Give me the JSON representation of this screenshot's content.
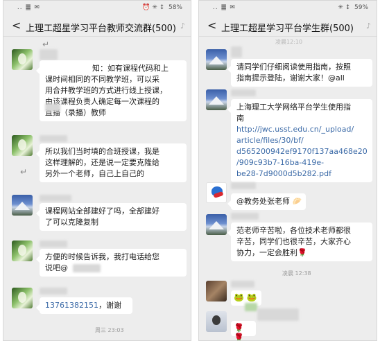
{
  "left": {
    "status_icons": " .. ䷀ ✉",
    "status_right": "⏰ ✳ ↕  58%",
    "back_glyph": "<",
    "title": "上理工超星学习平台教师交流群(500)",
    "bell": "♪",
    "messages": [
      {
        "lines": [
          "知：如有课程代码和上",
          "课时间相同的不同教学班，可以采",
          "用合并教学班的方式进行线上授课，",
          "由该课程负责人确定每一次课程的",
          "直播（录播）教师"
        ]
      },
      {
        "lines": [
          "所以我们当时填的合班授课，我是",
          "这样理解的，还是说一定要克隆给",
          "另外一个老师，自己上自己的"
        ]
      },
      {
        "lines": [
          "课程网站全部建好了吗，全部建好",
          "了可以克隆复制"
        ]
      },
      {
        "lines": [
          "方便的时候告诉我，我打电话给您",
          "说吧@"
        ]
      },
      {
        "phone": "13761382151",
        "suffix": "，谢谢"
      }
    ],
    "timestamp": "周三 23:03",
    "return_mark": "↵"
  },
  "right": {
    "status_icons": " .. ䷀ ✉",
    "status_right": "✳ ↕  59%",
    "back_glyph": "<",
    "title": "上理工超星学习平台学生群(500)",
    "bell": "♪",
    "top_timestamp": "凌晨12:10",
    "messages": [
      {
        "lines": [
          "请同学们仔细阅读使用指南，按照",
          "指南提示登陆，谢谢大家！@all"
        ]
      },
      {
        "title": "上海理工大学网络平台学生使用指",
        "title2": "南",
        "link_lines": [
          "http://jwc.usst.edu.cn/_upload/",
          "article/files/30/bf/",
          "d565200942ef9170f137aa468e20",
          "/909c93b7-16ba-419e-",
          "be28-7d9000d5b282.pdf"
        ]
      },
      {
        "text": "@教务处张老师",
        "emoji": "🥟"
      },
      {
        "lines": [
          "范老师辛苦啦，各位技术老师都很",
          "辛苦，同学们也很辛苦，大家齐心",
          "协力，一定会胜利"
        ],
        "emoji": "🌹"
      }
    ],
    "timestamp2": "凌晨 12:38",
    "emoji_row1": "🐸 🐸",
    "emoji_row2": "🌹 🌹"
  }
}
